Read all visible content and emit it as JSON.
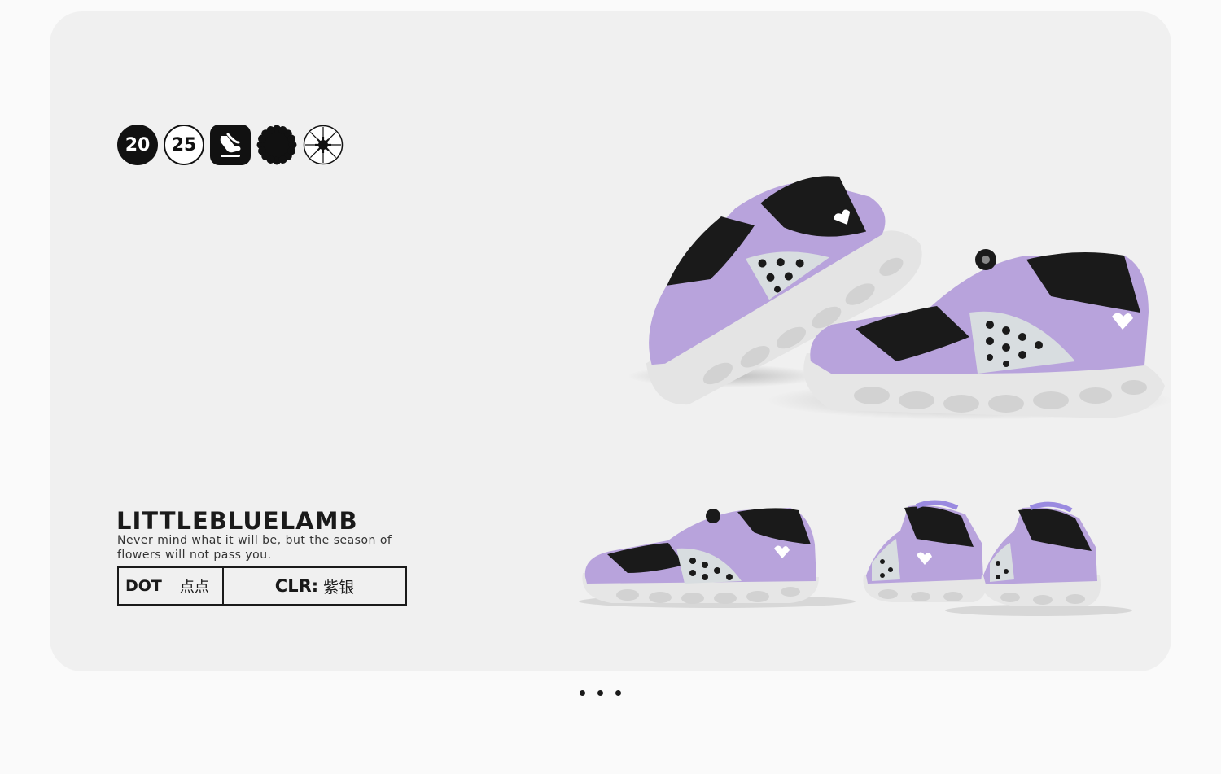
{
  "badges": {
    "year_left": "20",
    "year_right": "25",
    "icons": [
      "foot-icon",
      "flower-icon",
      "sunburst-icon"
    ]
  },
  "product": {
    "brand": "LITTLEBLUELAMB",
    "tagline": "Never mind what it will be, but the season of flowers will not pass you.",
    "code_label": "DOT",
    "code_cn": "点点",
    "color_label": "CLR:",
    "color_value": "紫银"
  },
  "pagination": {
    "dots": 3
  },
  "colors": {
    "lavender": "#b8a3dc",
    "black": "#1a1a1a",
    "sole": "#e6e6e6",
    "silver": "#d8dde0",
    "card_bg": "#f0f0f0"
  }
}
